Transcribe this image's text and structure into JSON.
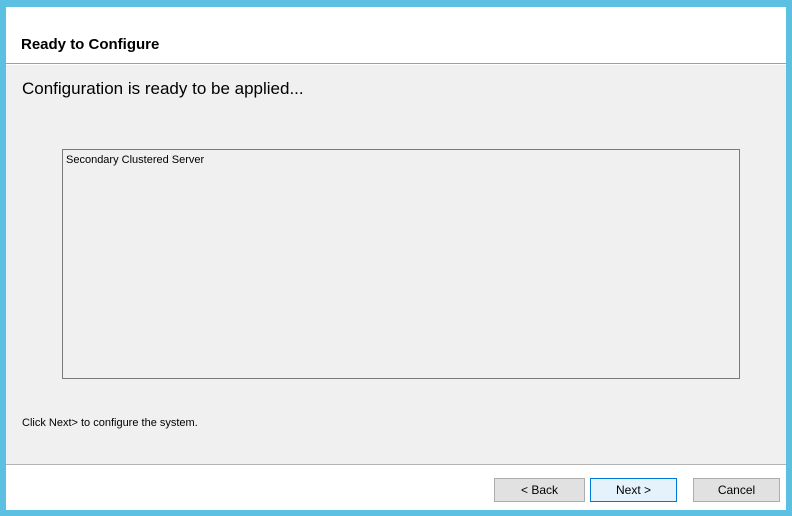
{
  "header": {
    "title": "Ready to Configure"
  },
  "content": {
    "status": "Configuration is ready to be applied...",
    "summary_lines": [
      "Secondary Clustered Server"
    ],
    "hint": "Click Next> to configure the system."
  },
  "footer": {
    "back_label": "< Back",
    "next_label": "Next >",
    "cancel_label": "Cancel"
  },
  "colors": {
    "window_border": "#5cc0e3",
    "panel_background": "#f0f0f0",
    "default_button_border": "#0078d7"
  }
}
